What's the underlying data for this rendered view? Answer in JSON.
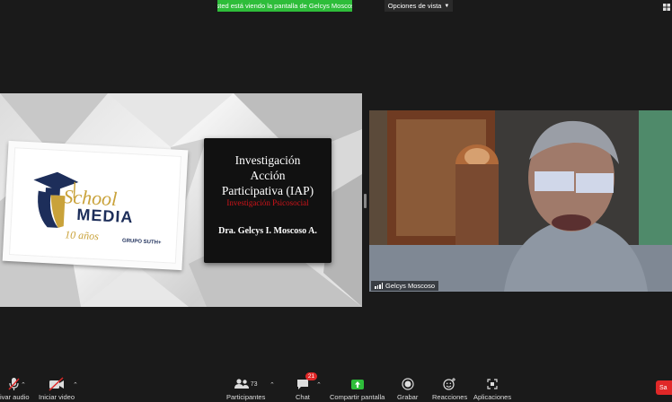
{
  "banner": {
    "sharing_text": "Usted está viendo la pantalla de Gelcys Moscoso",
    "view_options_label": "Opciones de vista"
  },
  "slide": {
    "title": "Investigación Acción Participativa (IAP)",
    "title_lines": [
      "Investigación",
      "Acción",
      "Participativa (IAP)"
    ],
    "subtitle": "Investigación Psicosocial",
    "author": "Dra. Gelcys I. Moscoso A.",
    "logo": {
      "school": "School",
      "media": "MEDIA",
      "anos": "10 años",
      "group": "GRUPO SUTH+"
    }
  },
  "video": {
    "participant_name": "Gelcys Moscoso"
  },
  "toolbar": {
    "audio_label": "ivar audio",
    "video_label": "Iniciar video",
    "participants_label": "Participantes",
    "participants_count": "73",
    "chat_label": "Chat",
    "chat_badge": "21",
    "share_label": "Compartir pantalla",
    "record_label": "Grabar",
    "reactions_label": "Reacciones",
    "apps_label": "Aplicaciones",
    "end_label": "Sa"
  },
  "colors": {
    "share_green": "#2ebd3a",
    "badge_red": "#e02828",
    "slide_red": "#d0141a",
    "logo_gold": "#c9a23a",
    "logo_navy": "#1d2e5a"
  }
}
